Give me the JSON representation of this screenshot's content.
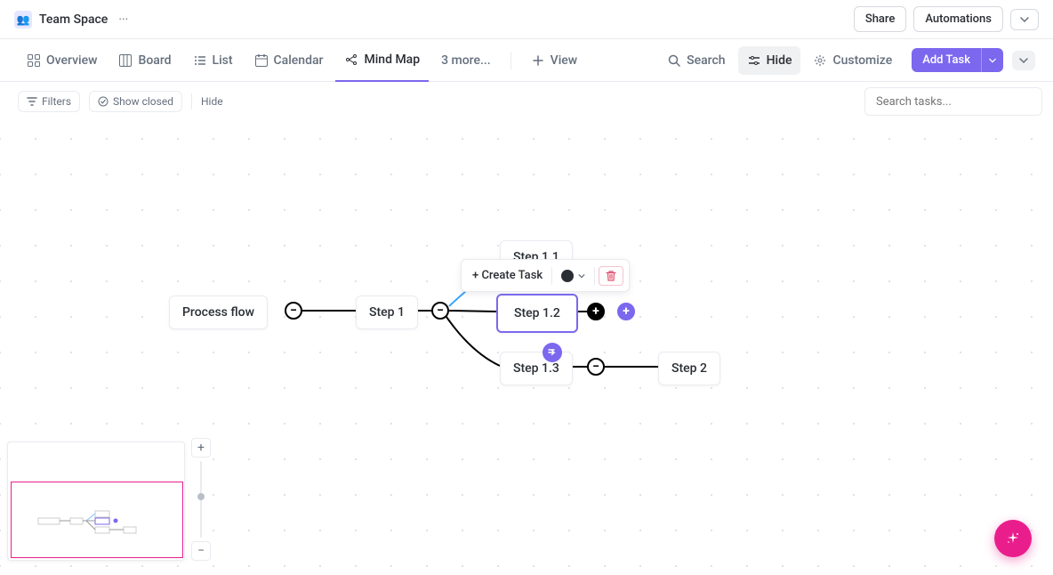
{
  "topbar": {
    "space_name": "Team Space",
    "share_label": "Share",
    "automations_label": "Automations"
  },
  "tabs": {
    "overview": "Overview",
    "board": "Board",
    "list": "List",
    "calendar": "Calendar",
    "mindmap": "Mind Map",
    "more": "3 more...",
    "view": "View"
  },
  "tabright": {
    "search": "Search",
    "hide": "Hide",
    "customize": "Customize",
    "add_task": "Add Task"
  },
  "filterbar": {
    "filters": "Filters",
    "show_closed": "Show closed",
    "hide": "Hide",
    "search_placeholder": "Search tasks..."
  },
  "context": {
    "create_task": "+ Create Task"
  },
  "nodes": {
    "root": "Process flow",
    "step1": "Step 1",
    "step11": "Step 1.1",
    "step12": "Step 1.2",
    "step13": "Step 1.3",
    "step2": "Step 2"
  }
}
